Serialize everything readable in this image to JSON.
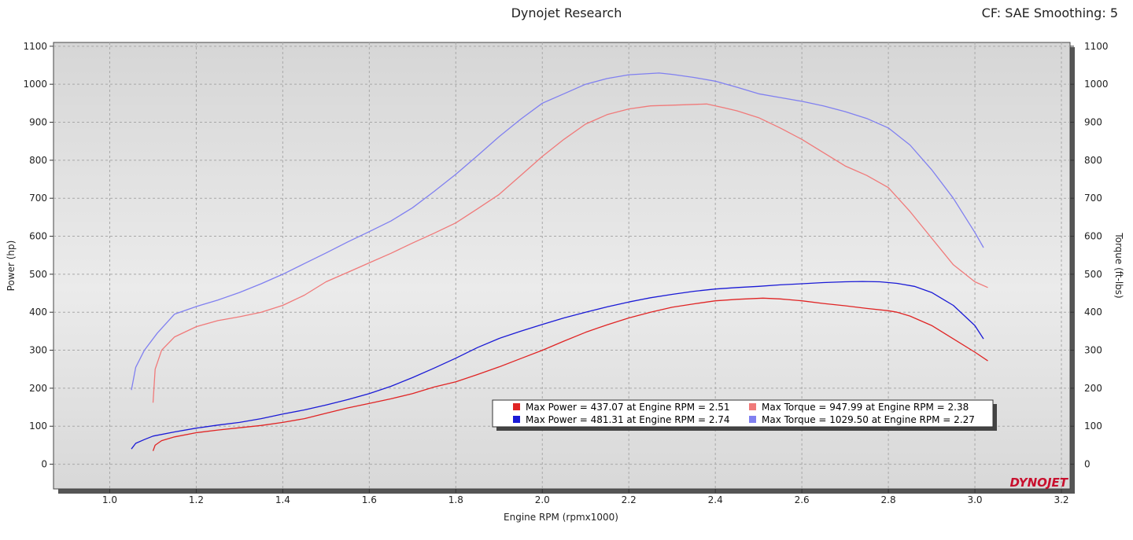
{
  "header": {
    "title": "Dynojet Research",
    "settings": "CF: SAE Smoothing: 5"
  },
  "logo": {
    "text": "DYNOJET",
    "color": "#c8102e"
  },
  "colors": {
    "power_red": "#e02424",
    "power_blue": "#1a1ad6",
    "torque_red": "#f07a7a",
    "torque_blue": "#8080f0"
  },
  "chart_data": {
    "type": "line",
    "title": "Dynojet Research",
    "subtitle": "CF: SAE Smoothing: 5",
    "xlabel": "Engine RPM (rpmx1000)",
    "ylabel_left": "Power (hp)",
    "ylabel_right": "Torque (ft-lbs)",
    "xlim": [
      0.87,
      3.22
    ],
    "ylim": [
      -65,
      1110
    ],
    "x_ticks": [
      1.0,
      1.2,
      1.4,
      1.6,
      1.8,
      2.0,
      2.2,
      2.4,
      2.6,
      2.8,
      3.0,
      3.2
    ],
    "y_ticks": [
      0,
      100,
      200,
      300,
      400,
      500,
      600,
      700,
      800,
      900,
      1000,
      1100
    ],
    "grid": true,
    "series": [
      {
        "axis": "left",
        "color": "#e02424",
        "x": [
          1.1,
          1.105,
          1.12,
          1.15,
          1.2,
          1.25,
          1.3,
          1.35,
          1.4,
          1.45,
          1.5,
          1.55,
          1.6,
          1.65,
          1.7,
          1.75,
          1.8,
          1.85,
          1.9,
          1.95,
          2.0,
          2.05,
          2.1,
          2.15,
          2.2,
          2.25,
          2.3,
          2.35,
          2.4,
          2.45,
          2.51,
          2.55,
          2.6,
          2.65,
          2.7,
          2.75,
          2.8,
          2.82,
          2.85,
          2.9,
          2.95,
          3.0,
          3.03
        ],
        "y": [
          35,
          50,
          62,
          72,
          83,
          90,
          96,
          102,
          110,
          120,
          134,
          148,
          160,
          172,
          186,
          203,
          217,
          236,
          256,
          278,
          300,
          324,
          347,
          367,
          385,
          400,
          413,
          422,
          430,
          434,
          437,
          435,
          430,
          423,
          417,
          410,
          404,
          400,
          390,
          365,
          330,
          295,
          272
        ]
      },
      {
        "axis": "left",
        "color": "#1a1ad6",
        "x": [
          1.05,
          1.06,
          1.08,
          1.1,
          1.15,
          1.2,
          1.25,
          1.3,
          1.35,
          1.4,
          1.45,
          1.5,
          1.55,
          1.6,
          1.65,
          1.7,
          1.75,
          1.8,
          1.85,
          1.9,
          1.95,
          2.0,
          2.05,
          2.1,
          2.15,
          2.2,
          2.25,
          2.3,
          2.35,
          2.4,
          2.45,
          2.5,
          2.55,
          2.6,
          2.65,
          2.7,
          2.74,
          2.78,
          2.82,
          2.86,
          2.9,
          2.95,
          3.0,
          3.02
        ],
        "y": [
          40,
          55,
          65,
          74,
          85,
          95,
          103,
          110,
          120,
          132,
          143,
          156,
          170,
          186,
          205,
          228,
          253,
          279,
          307,
          331,
          350,
          368,
          385,
          400,
          414,
          427,
          438,
          447,
          455,
          461,
          465,
          468,
          472,
          475,
          478,
          480,
          481,
          480,
          476,
          468,
          452,
          418,
          365,
          330
        ]
      },
      {
        "axis": "right",
        "color": "#f07a7a",
        "x": [
          1.1,
          1.105,
          1.12,
          1.15,
          1.2,
          1.25,
          1.3,
          1.35,
          1.4,
          1.45,
          1.5,
          1.55,
          1.6,
          1.65,
          1.7,
          1.75,
          1.8,
          1.85,
          1.9,
          1.95,
          2.0,
          2.05,
          2.1,
          2.15,
          2.2,
          2.25,
          2.3,
          2.38,
          2.42,
          2.45,
          2.5,
          2.55,
          2.6,
          2.65,
          2.7,
          2.75,
          2.8,
          2.85,
          2.9,
          2.95,
          3.0,
          3.03
        ],
        "y": [
          162,
          250,
          300,
          335,
          362,
          378,
          388,
          400,
          418,
          445,
          480,
          505,
          530,
          555,
          582,
          608,
          635,
          672,
          710,
          760,
          810,
          855,
          895,
          920,
          935,
          943,
          945,
          947.99,
          938,
          930,
          912,
          885,
          855,
          820,
          785,
          760,
          728,
          665,
          595,
          525,
          480,
          465
        ]
      },
      {
        "axis": "right",
        "color": "#8080f0",
        "x": [
          1.05,
          1.06,
          1.08,
          1.11,
          1.15,
          1.2,
          1.25,
          1.3,
          1.35,
          1.4,
          1.45,
          1.5,
          1.55,
          1.6,
          1.65,
          1.7,
          1.75,
          1.8,
          1.85,
          1.9,
          1.95,
          2.0,
          2.05,
          2.1,
          2.15,
          2.2,
          2.27,
          2.3,
          2.35,
          2.4,
          2.45,
          2.5,
          2.55,
          2.6,
          2.65,
          2.7,
          2.75,
          2.8,
          2.85,
          2.9,
          2.95,
          3.0,
          3.02
        ],
        "y": [
          195,
          255,
          300,
          345,
          395,
          415,
          432,
          452,
          475,
          500,
          528,
          556,
          585,
          612,
          640,
          675,
          718,
          763,
          812,
          862,
          908,
          950,
          975,
          1000,
          1015,
          1025,
          1029.5,
          1026,
          1018,
          1008,
          992,
          975,
          965,
          955,
          943,
          928,
          910,
          885,
          840,
          775,
          700,
          610,
          570
        ]
      }
    ],
    "legend_placement": "bottom-right",
    "legend": [
      {
        "text": "Max Power = 437.07 at Engine RPM = 2.51",
        "color": "#e02424"
      },
      {
        "text": "Max Torque = 947.99 at Engine RPM = 2.38",
        "color": "#f07a7a"
      },
      {
        "text": "Max Power = 481.31 at Engine RPM = 2.74",
        "color": "#1a1ad6"
      },
      {
        "text": "Max Torque = 1029.50 at Engine RPM = 2.27",
        "color": "#8080f0"
      }
    ]
  }
}
